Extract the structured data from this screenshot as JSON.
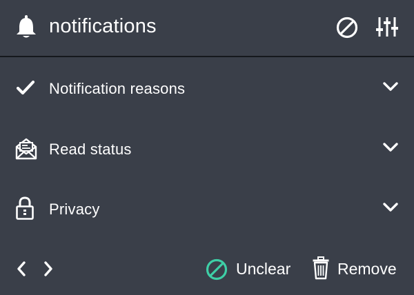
{
  "header": {
    "title": "notifications",
    "icon": "bell-icon",
    "actions": [
      {
        "name": "block-icon"
      },
      {
        "name": "sliders-icon"
      }
    ]
  },
  "sections": [
    {
      "label": "Notification reasons",
      "icon": "checkmark-icon"
    },
    {
      "label": "Read status",
      "icon": "open-envelope-icon"
    },
    {
      "label": "Privacy",
      "icon": "lock-icon"
    }
  ],
  "footer": {
    "prev_icon": "chevron-left-icon",
    "next_icon": "chevron-right-icon",
    "unclear_label": "Unclear",
    "remove_label": "Remove"
  },
  "colors": {
    "background": "#3a3f49",
    "divider": "#15181d",
    "text": "#ffffff",
    "accent": "#3ecfa6"
  }
}
